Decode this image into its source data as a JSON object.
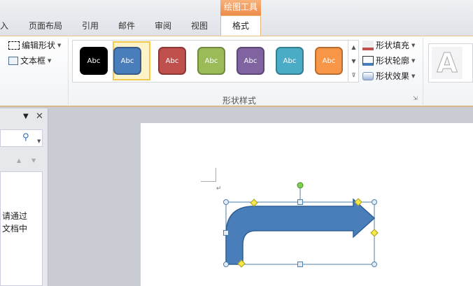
{
  "tabs": [
    {
      "label": "入"
    },
    {
      "label": "页面布局"
    },
    {
      "label": "引用"
    },
    {
      "label": "邮件"
    },
    {
      "label": "审阅"
    },
    {
      "label": "视图"
    }
  ],
  "contextual": {
    "group": "绘图工具",
    "tab": "格式"
  },
  "insert_group": {
    "edit_shape": "编辑形状",
    "text_box": "文本框"
  },
  "shape_styles": {
    "label": "形状样式",
    "swatches": [
      {
        "text": "Abc",
        "fill": "#000000",
        "border": "#000000"
      },
      {
        "text": "Abc",
        "fill": "#4a7ebb",
        "border": "#385d8a"
      },
      {
        "text": "Abc",
        "fill": "#c0504d",
        "border": "#8c3836"
      },
      {
        "text": "Abc",
        "fill": "#9bbb59",
        "border": "#71893f"
      },
      {
        "text": "Abc",
        "fill": "#8064a2",
        "border": "#5c4776"
      },
      {
        "text": "Abc",
        "fill": "#4bacc6",
        "border": "#357d91"
      },
      {
        "text": "Abc",
        "fill": "#f79646",
        "border": "#b66d31"
      }
    ],
    "fill": "形状填充",
    "outline": "形状轮廓",
    "effects": "形状效果"
  },
  "pane": {
    "text_line1": "请通过",
    "text_line2": "文档中"
  }
}
